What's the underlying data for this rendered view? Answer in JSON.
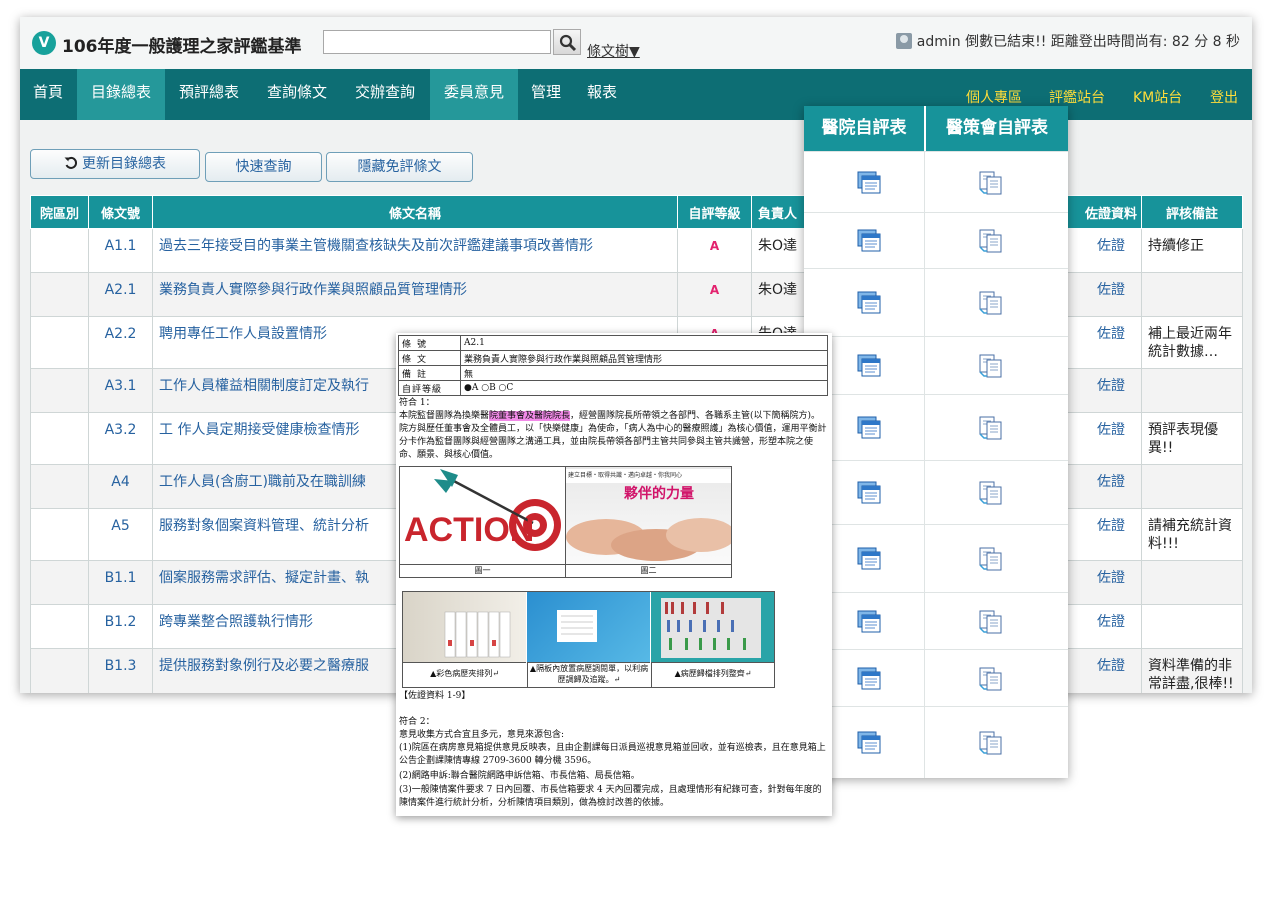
{
  "header": {
    "title": "106年度一般護理之家評鑑基準",
    "logo_letter": "V",
    "search_value": "",
    "tree_link": "條文樹▼",
    "user_status": "admin 倒數已結束!! 距離登出時間尚有: 82 分 8 秒"
  },
  "nav": {
    "left": [
      "首頁",
      "目錄總表",
      "預評總表",
      "查詢條文",
      "交辦查詢",
      "委員意見",
      "管理",
      "報表"
    ],
    "right": [
      "個人專區",
      "評鑑站台",
      "KM站台",
      "登出"
    ]
  },
  "toolbar": {
    "refresh": "更新目錄總表",
    "quick_search": "快速查詢",
    "hide_exempt": "隱藏免評條文"
  },
  "table": {
    "headers": [
      "院區別",
      "條文號",
      "條文名稱",
      "自評等級",
      "負責人",
      "佐證資料",
      "評核備註"
    ],
    "rows": [
      {
        "code": "A1.1",
        "name": "過去三年接受目的事業主管機關查核缺失及前次評鑑建議事項改善情形",
        "grade": "A",
        "owner": "朱O達",
        "evidence": "佐證",
        "note": "持續修正"
      },
      {
        "code": "A2.1",
        "name": "業務負責人實際參與行政作業與照顧品質管理情形",
        "grade": "A",
        "owner": "朱O達",
        "evidence": "佐證",
        "note": ""
      },
      {
        "code": "A2.2",
        "name": "聘用專任工作人員設置情形",
        "grade": "A",
        "owner": "朱O達",
        "evidence": "佐證",
        "note": "補上最近兩年統計數據…"
      },
      {
        "code": "A3.1",
        "name": "工作人員權益相關制度訂定及執行",
        "grade": "",
        "owner": "",
        "evidence": "佐證",
        "note": ""
      },
      {
        "code": "A3.2",
        "name": "工 作人員定期接受健康檢查情形",
        "grade": "",
        "owner": "",
        "evidence": "佐證",
        "note": "預評表現優異!!"
      },
      {
        "code": "A4",
        "name": "工作人員(含廚工)職前及在職訓練",
        "grade": "",
        "owner": "",
        "evidence": "佐證",
        "note": ""
      },
      {
        "code": "A5",
        "name": "服務對象個案資料管理、統計分析",
        "grade": "",
        "owner": "",
        "evidence": "佐證",
        "note": "請補充統計資料!!!"
      },
      {
        "code": "B1.1",
        "name": "個案服務需求評估、擬定計畫、執",
        "grade": "",
        "owner": "",
        "evidence": "佐證",
        "note": ""
      },
      {
        "code": "B1.2",
        "name": "跨專業整合照護執行情形",
        "grade": "",
        "owner": "",
        "evidence": "佐證",
        "note": ""
      },
      {
        "code": "B1.3",
        "name": "提供服務對象例行及必要之醫療服",
        "grade": "",
        "owner": "",
        "evidence": "佐證",
        "note": "資料準備的非常詳盡,很棒!!"
      }
    ]
  },
  "panel": {
    "headers": [
      "醫院自評表",
      "醫策會自評表"
    ]
  },
  "doc": {
    "meta": [
      {
        "key": "條號",
        "value": "A2.1"
      },
      {
        "key": "條文",
        "value": "業務負責人實際參與行政作業與照顧品質管理情形"
      },
      {
        "key": "備註",
        "value": "無"
      },
      {
        "key": "自評等級",
        "value": "●A ○B ○C"
      }
    ],
    "section1_title": "符合 1：",
    "para1_a": "本院監督團隊為換樂醫",
    "para1_mark": "院董事會及醫院院長",
    "para1_b": "，經營團隊院長所帶領之各部門、各職系主管(以下簡稱院方)。院方與歷任董事會及全體員工，以「快樂健康」為使命，「病人為中心的醫療照護」為核心價值，運用平衡計分卡作為監督團隊與經營團隊之溝通工具，並由院長帶領各部門主管共同參與主管共識營，形塑本院之使命、願景、與核心價值。",
    "fig1_caption": "圖一",
    "fig2_caption": "圖二",
    "fig2_subtitle": "建立目標・取得共識・邁向卓越・你我同心",
    "fig2_slogan": "夥伴的力量",
    "action_word": "ACTION",
    "photo_captions": [
      "▲彩色病歷夾排列↵",
      "▲隔板內放置病歷調閱單，以利病歷調歸及追蹤。↵",
      "▲病歷歸檔排列整齊↵"
    ],
    "evidence_ref": "【佐證資料 1-9】",
    "section2_title": "符合 2：",
    "para2_a": "意見收集方式合宜且多元，意見來源包含:",
    "para2_b": "(1)院區在病房意見箱提供意見反映表，且由企劃課每日派員巡視意見箱並回收，並有巡檢表，且在意見箱上公告企劃課陳情專線 2709-3600 轉分機 3596。",
    "para2_c": "(2)網路申訴:聯合醫院網路申訴信箱、市長信箱、局長信箱。",
    "para2_d": "(3)一般陳情案件要求 7 日內回覆、市長信箱要求 4 天內回覆完成，且處理情形有紀錄可查，針對每年度的陳情案件進行統計分析，分析陳情項目類別，做為檢討改善的依據。"
  },
  "colors": {
    "nav_bg": "#0d6e74",
    "nav_active": "#25989a",
    "header_teal": "#17939a",
    "link_blue": "#2762a0",
    "grade_pink": "#e3226e",
    "nav_right_yellow": "#ffdd3a"
  },
  "icons": [
    "search-icon",
    "refresh-icon",
    "form-window-icon",
    "copy-document-icon",
    "user-avatar-icon"
  ]
}
